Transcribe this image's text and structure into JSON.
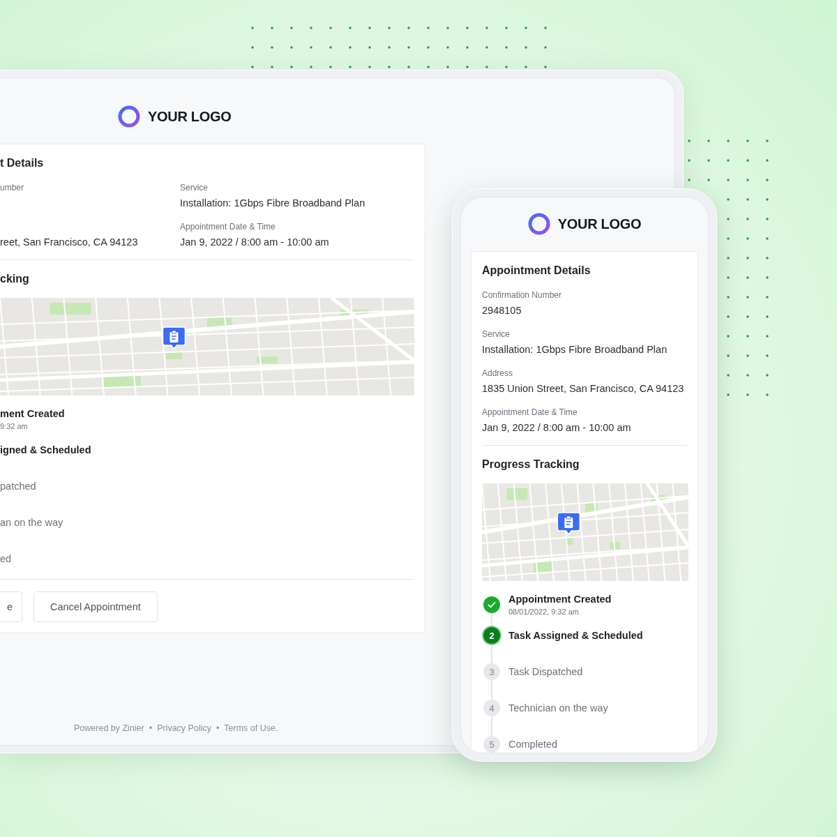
{
  "tablet": {
    "logo": "YOUR LOGO",
    "details_title": "t Details",
    "field_columns": [
      [
        {
          "label": "umber"
        },
        {
          "value": "reet, San Francisco, CA 94123"
        }
      ],
      [
        {
          "label": "Service",
          "value": "Installation: 1Gbps Fibre Broadband Plan"
        },
        {
          "label": "Appointment Date & Time",
          "value": "Jan 9, 2022 / 8:00 am - 10:00 am"
        }
      ]
    ],
    "tracking_title": "cking",
    "steps": [
      {
        "title": "ment Created",
        "sub": "9:32 am",
        "reached": true
      },
      {
        "title": "igned & Scheduled",
        "reached": true
      },
      {
        "title": "patched",
        "reached": false
      },
      {
        "title": "an on the way",
        "reached": false
      },
      {
        "title": "ed",
        "reached": false
      }
    ],
    "buttons": [
      "e",
      "Cancel Appointment"
    ],
    "footer": {
      "credit": "Powered by Zinier",
      "separators": [
        "•",
        "•"
      ],
      "links": [
        "Privacy Policy",
        "Terms of Use."
      ]
    }
  },
  "phone": {
    "logo": "YOUR LOGO",
    "details_title": "Appointment Details",
    "fields": [
      {
        "label": "Confirmation Number",
        "value": "2948105"
      },
      {
        "label": "Service",
        "value": "Installation: 1Gbps Fibre Broadband Plan"
      },
      {
        "label": "Address",
        "value": "1835 Union Street, San Francisco, CA 94123"
      },
      {
        "label": "Appointment Date & Time",
        "value": "Jan 9, 2022 / 8:00 am - 10:00 am"
      }
    ],
    "tracking_title": "Progress Tracking",
    "steps": [
      {
        "title": "Appointment Created",
        "sub": "08/01/2022, 9:32 am",
        "reached": true,
        "active": false
      },
      {
        "number": "2",
        "title": "Task Assigned & Scheduled",
        "reached": true,
        "active": true
      },
      {
        "number": "3",
        "title": "Task Dispatched",
        "reached": false,
        "active": false
      },
      {
        "number": "4",
        "title": "Technician on the way",
        "reached": false,
        "active": false
      },
      {
        "number": "5",
        "title": "Completed",
        "reached": false,
        "active": false
      }
    ]
  }
}
